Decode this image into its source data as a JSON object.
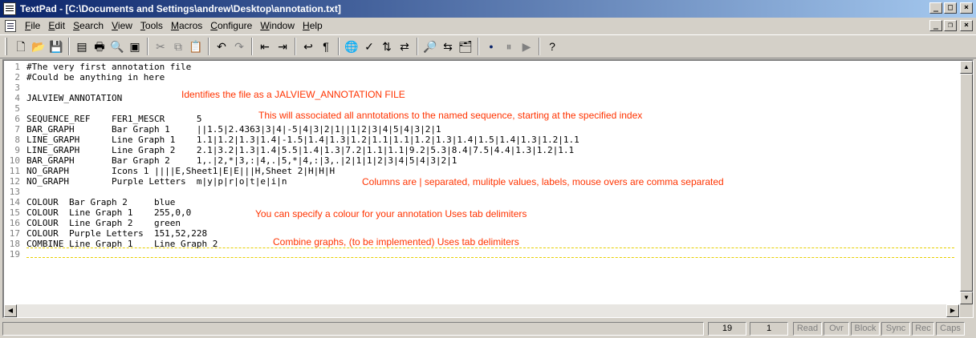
{
  "window": {
    "title": "TextPad - [C:\\Documents and Settings\\andrew\\Desktop\\annotation.txt]"
  },
  "menu": [
    {
      "label": "File",
      "u": "F",
      "rest": "ile"
    },
    {
      "label": "Edit",
      "u": "E",
      "rest": "dit"
    },
    {
      "label": "Search",
      "u": "S",
      "rest": "earch"
    },
    {
      "label": "View",
      "u": "V",
      "rest": "iew"
    },
    {
      "label": "Tools",
      "u": "T",
      "rest": "ools"
    },
    {
      "label": "Macros",
      "u": "M",
      "rest": "acros"
    },
    {
      "label": "Configure",
      "u": "C",
      "rest": "onfigure"
    },
    {
      "label": "Window",
      "u": "W",
      "rest": "indow"
    },
    {
      "label": "Help",
      "u": "H",
      "rest": "elp"
    }
  ],
  "toolbar_icons": [
    "new-file-icon",
    "open-file-icon",
    "save-icon",
    "separator",
    "page-setup-icon",
    "print-icon",
    "print-preview-icon",
    "document-properties-icon",
    "separator",
    "cut-icon",
    "copy-icon",
    "paste-icon",
    "separator",
    "undo-icon",
    "redo-icon",
    "separator",
    "unindent-icon",
    "indent-icon",
    "separator",
    "word-wrap-icon",
    "pilcrow-icon",
    "separator",
    "web-browser-icon",
    "spell-check-icon",
    "sort-icon",
    "compare-icon",
    "separator",
    "find-icon",
    "replace-icon",
    "find-in-files-icon",
    "separator",
    "record-macro-icon",
    "pause-macro-icon",
    "play-macro-icon",
    "separator",
    "context-help-icon"
  ],
  "editor": {
    "lines": [
      {
        "n": "1",
        "text": "#The very first annotation file"
      },
      {
        "n": "2",
        "text": "#Could be anything in here"
      },
      {
        "n": "3",
        "text": ""
      },
      {
        "n": "4",
        "text": "JALVIEW_ANNOTATION"
      },
      {
        "n": "5",
        "text": ""
      },
      {
        "n": "6",
        "text": "SEQUENCE_REF    FER1_MESCR      5"
      },
      {
        "n": "7",
        "text": "BAR_GRAPH       Bar Graph 1     ||1.5|2.4363|3|4|-5|4|3|2|1||1|2|3|4|5|4|3|2|1"
      },
      {
        "n": "8",
        "text": "LINE_GRAPH      Line Graph 1    1.1|1.2|1.3|1.4|-1.5|1.4|1.3|1.2|1.1|1.1|1.2|1.3|1.4|1.5|1.4|1.3|1.2|1.1"
      },
      {
        "n": "9",
        "text": "LINE_GRAPH      Line Graph 2    2.1|3.2|1.3|1.4|5.5|1.4|1.3|7.2|1.1|1.1|9.2|5.3|8.4|7.5|4.4|1.3|1.2|1.1"
      },
      {
        "n": "10",
        "text": "BAR_GRAPH       Bar Graph 2     1,.|2,*|3,:|4,.|5,*|4,:|3,.|2|1|1|2|3|4|5|4|3|2|1"
      },
      {
        "n": "11",
        "text": "NO_GRAPH        Icons 1 ||||E,Sheet1|E|E|||H,Sheet 2|H|H|H"
      },
      {
        "n": "12",
        "text": "NO_GRAPH        Purple Letters  m|y|p|r|o|t|e|i|n"
      },
      {
        "n": "13",
        "text": ""
      },
      {
        "n": "14",
        "text": "COLOUR  Bar Graph 2     blue"
      },
      {
        "n": "15",
        "text": "COLOUR  Line Graph 1    255,0,0"
      },
      {
        "n": "16",
        "text": "COLOUR  Line Graph 2    green"
      },
      {
        "n": "17",
        "text": "COLOUR  Purple Letters  151,52,228"
      },
      {
        "n": "18",
        "text": "COMBINE Line Graph 1    Line Graph 2"
      },
      {
        "n": "19",
        "text": ""
      }
    ],
    "annotations": {
      "identifies": "Identifies the file as a JALVIEW_ANNOTATION FILE",
      "associate": "This will associated all anntotations to the named sequence, starting at the specified index",
      "columns": "Columns are | separated, mulitple values, labels, mouse overs are comma separated",
      "colour": "You can specify a colour for your annotation Uses tab delimiters",
      "combine": "Combine graphs, (to be implemented) Uses tab delimiters"
    },
    "annotation_color": "#ff3300"
  },
  "status": {
    "line": "19",
    "column": "1",
    "flags": [
      "Read",
      "Ovr",
      "Block",
      "Sync",
      "Rec",
      "Caps"
    ]
  }
}
